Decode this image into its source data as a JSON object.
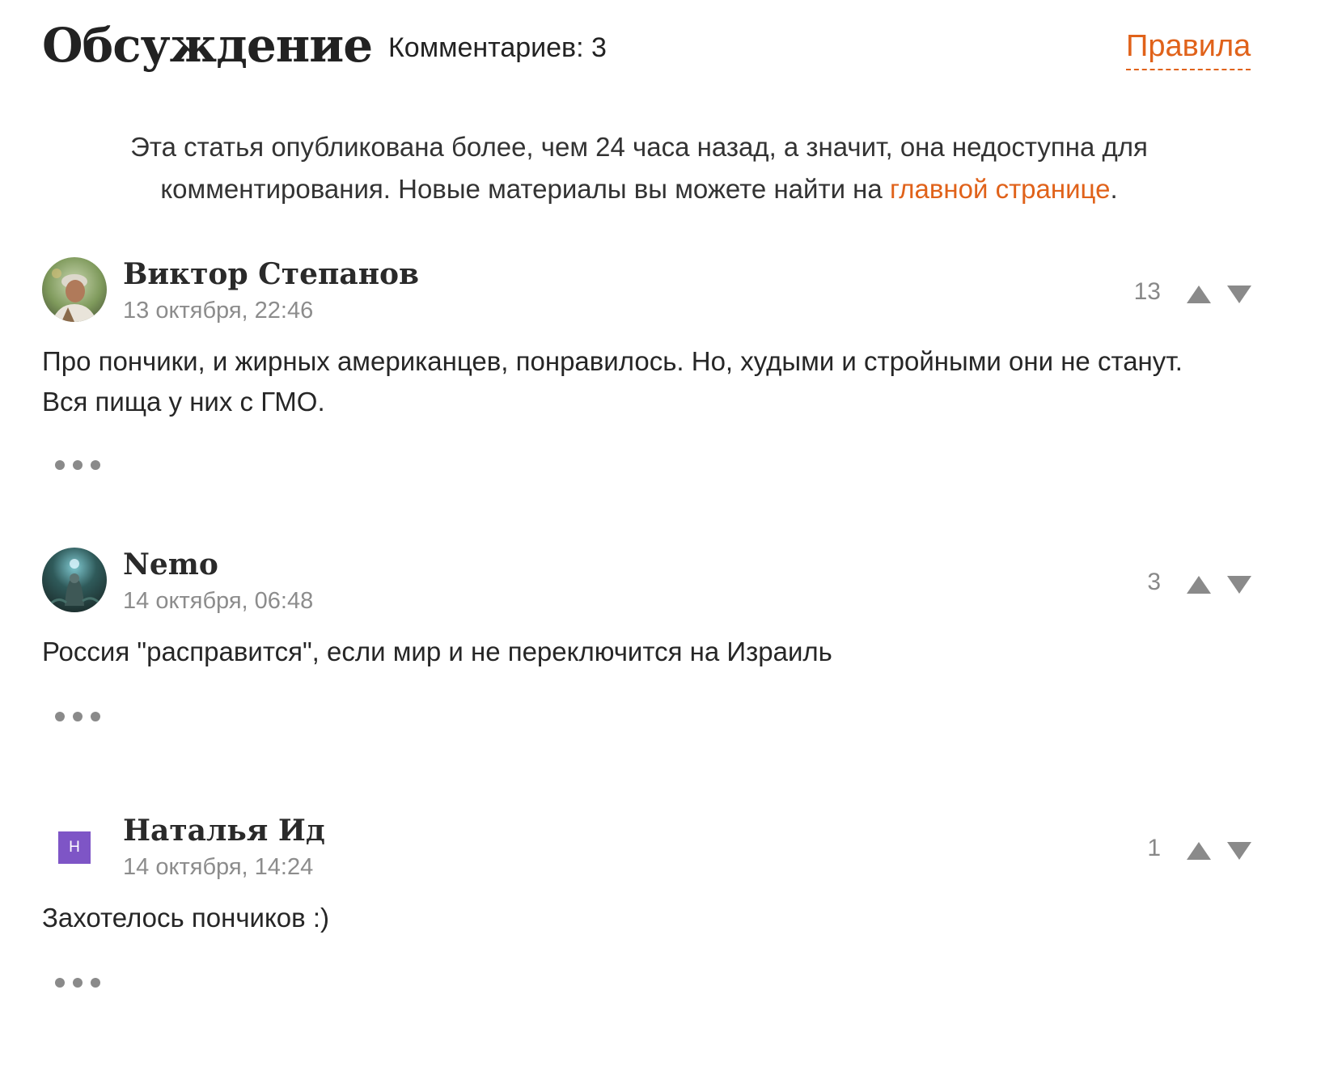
{
  "header": {
    "title": "Обсуждение",
    "comments_count": "Комментариев: 3",
    "rules_link": "Правила"
  },
  "notice": {
    "text_before": "Эта статья опубликована более, чем 24 часа назад, а значит, она недоступна для комментирования. Новые материалы вы можете найти на ",
    "link_text": "главной странице",
    "text_after": "."
  },
  "comments": [
    {
      "author": "Виктор Степанов",
      "date": "13 октября, 22:46",
      "score": "13",
      "text": "Про пончики, и жирных американцев, понравилось. Но, худыми и стройными они не станут. Вся пища у них с ГМО.",
      "avatar_icon": "user-photo-avatar"
    },
    {
      "author": "Nemo",
      "date": "14 октября, 06:48",
      "score": "3",
      "text": "Россия \"расправится\", если мир и не переключится на Израиль",
      "avatar_icon": "user-image-avatar"
    },
    {
      "author": "Наталья Ид",
      "date": "14 октября, 14:24",
      "score": "1",
      "text": "Захотелось пончиков :)",
      "avatar_letter": "Н",
      "avatar_color": "#7e55c6"
    }
  ],
  "colors": {
    "accent": "#e0621a",
    "muted": "#8c8c8c",
    "arrow": "#8a8a8a"
  },
  "icons": {
    "upvote": "triangle-up-icon",
    "downvote": "triangle-down-icon",
    "more": "more-dots-icon"
  }
}
